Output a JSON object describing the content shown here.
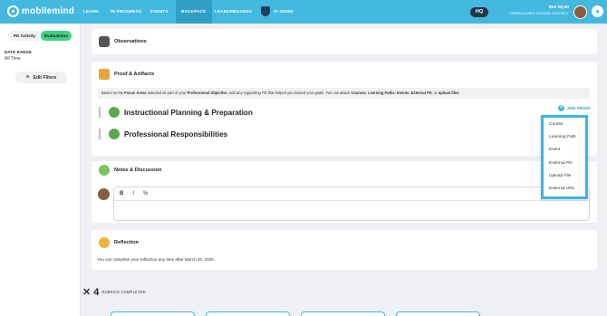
{
  "nav": {
    "logo": "mobilemind",
    "items": [
      "LEARN",
      "IN PROGRESS",
      "EVENTS",
      "BACKPACK",
      "LEADERBOARDS",
      "AI GENIE"
    ],
    "hq": "HQ",
    "user_name": "Ben Wyatt",
    "user_org": "GREEN ACRES SCHOOL DISTRICT"
  },
  "sidebar": {
    "tabs": [
      "PD Activity",
      "Evaluations"
    ],
    "active_tab": "Evaluations",
    "date_range_title": "DATE RANGE",
    "date_range_value": "All Time",
    "edit_filters": "Edit Filters"
  },
  "observations": {
    "title": "Observations"
  },
  "proof": {
    "title": "Proof & Artifacts",
    "info_prefix": "Based on the ",
    "info_b1": "Focus Areas",
    "info_mid1": " selected as part of your ",
    "info_b2": "Professional Objective",
    "info_mid2": ", add any supporting PD that helped you toward your goals. You can attach ",
    "info_b3": "Courses",
    "info_sep1": ", ",
    "info_b4": "Learning Paths",
    "info_sep2": ", ",
    "info_b5": "Events",
    "info_sep3": ", ",
    "info_b6": "External PD",
    "info_mid3": ", or ",
    "info_b7": "upload files",
    "info_end": ".",
    "sections": [
      "Instructional Planning & Preparation",
      "Professional Responsibilities"
    ],
    "add_proof": "ADD PROOF"
  },
  "dropdown": {
    "items": [
      "Course",
      "Learning Path",
      "Event",
      "External PD",
      "Upload File",
      "External URL"
    ]
  },
  "notes": {
    "title": "Notes & Discussion",
    "tools": [
      "B",
      "I",
      "%"
    ]
  },
  "reflection": {
    "title": "Reflection",
    "text": "You can complete your reflection any time after March 30, 2026."
  },
  "rubrics": {
    "count": "4",
    "label": "RUBRICS COMPLETED"
  },
  "colors": {
    "nav_bg": "#44b9df",
    "accent_green": "#3fd17e",
    "dropdown_border": "#3ab5e8"
  }
}
